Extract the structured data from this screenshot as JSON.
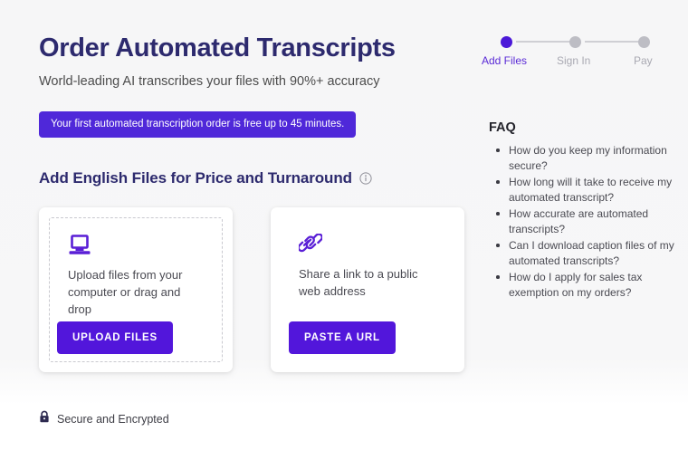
{
  "header": {
    "title": "Order Automated Transcripts",
    "subtitle": "World-leading AI transcribes your files with 90%+ accuracy",
    "promo_banner": "Your first automated transcription order is free up to 45 minutes."
  },
  "section": {
    "title": "Add English Files for Price and Turnaround",
    "info_icon": "info-circle-icon"
  },
  "cards": [
    {
      "icon": "laptop-icon",
      "text": "Upload files from your computer or drag and drop",
      "button_label": "UPLOAD FILES",
      "dashed": true
    },
    {
      "icon": "link-icon",
      "text": "Share a link to a public web address",
      "button_label": "PASTE A URL",
      "dashed": false
    }
  ],
  "footer": {
    "secure_icon": "lock-icon",
    "secure_text": "Secure and Encrypted"
  },
  "stepper": {
    "steps": [
      {
        "label": "Add Files",
        "state": "active"
      },
      {
        "label": "Sign In",
        "state": "inactive"
      },
      {
        "label": "Pay",
        "state": "inactive"
      }
    ]
  },
  "faq": {
    "title": "FAQ",
    "items": [
      "How do you keep my information secure?",
      "How long will it take to receive my automated transcript?",
      "How accurate are automated transcripts?",
      "Can I download caption files of my automated transcripts?",
      "How do I apply for sales tax exemption on my orders?"
    ]
  },
  "colors": {
    "brand_purple": "#5216db",
    "banner_purple": "#4f28d9",
    "title_navy": "#2d2a6e",
    "step_inactive": "#bdbdc4"
  }
}
